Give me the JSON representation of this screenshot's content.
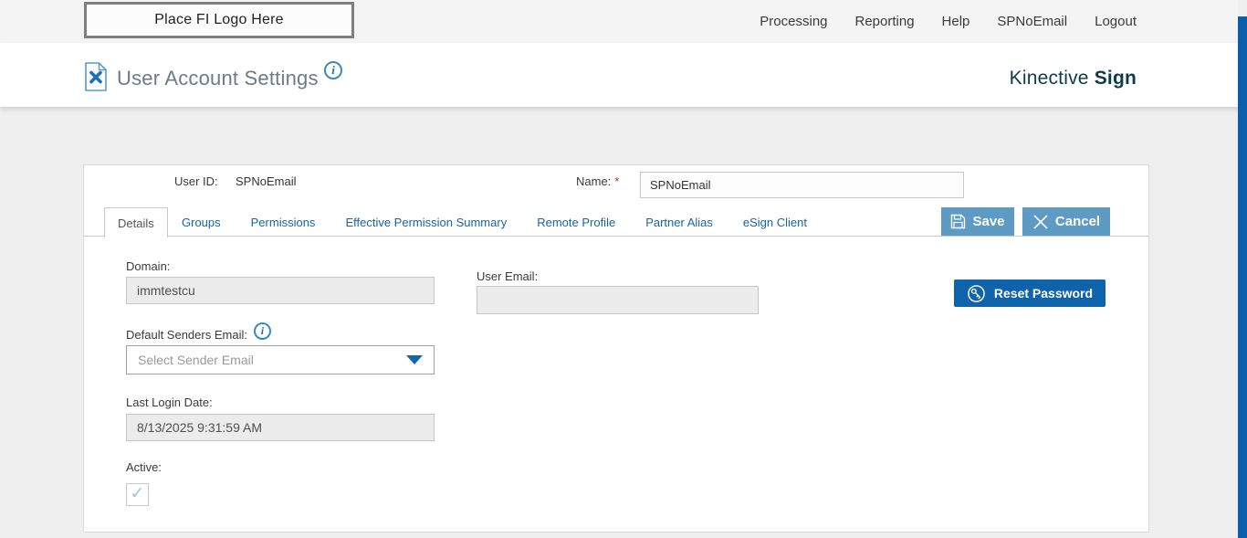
{
  "topbar": {
    "logo_placeholder": "Place FI Logo Here",
    "nav": [
      {
        "label": "Processing"
      },
      {
        "label": "Reporting"
      },
      {
        "label": "Help"
      },
      {
        "label": "SPNoEmail"
      },
      {
        "label": "Logout"
      }
    ]
  },
  "header": {
    "title": "User Account Settings",
    "info_glyph": "i",
    "brand_name": "Kinective",
    "brand_product": "Sign"
  },
  "form": {
    "user_id": {
      "label": "User ID:",
      "value": "SPNoEmail"
    },
    "name": {
      "label": "Name:",
      "required_marker": "*",
      "value": "SPNoEmail"
    },
    "tabs": [
      {
        "label": "Details",
        "active": true
      },
      {
        "label": "Groups"
      },
      {
        "label": "Permissions"
      },
      {
        "label": "Effective Permission Summary"
      },
      {
        "label": "Remote Profile"
      },
      {
        "label": "Partner Alias"
      },
      {
        "label": "eSign Client"
      }
    ],
    "actions": {
      "save": "Save",
      "cancel": "Cancel"
    },
    "fields": {
      "domain": {
        "label": "Domain:",
        "value": "immtestcu"
      },
      "user_email": {
        "label": "User Email:",
        "value": ""
      },
      "default_senders_email": {
        "label": "Default Senders Email:",
        "info_glyph": "i",
        "placeholder": "Select Sender Email"
      },
      "last_login_date": {
        "label": "Last Login Date:",
        "value": "8/13/2025 9:31:59 AM"
      },
      "active": {
        "label": "Active:",
        "checked": true,
        "checkmark": "✓"
      }
    },
    "reset_password_label": "Reset Password"
  },
  "colors": {
    "topbar_bg": "#f4f4f4",
    "body_bg": "#efefef",
    "tab_link_blue": "#1664ab",
    "steel_button_blue": "#5d9bc4",
    "primary_button_blue": "#0f63ab",
    "scrollbar_blue": "#0b5ea9",
    "brand_teal": "#0e3a4a",
    "title_gray": "#6d7b84"
  }
}
